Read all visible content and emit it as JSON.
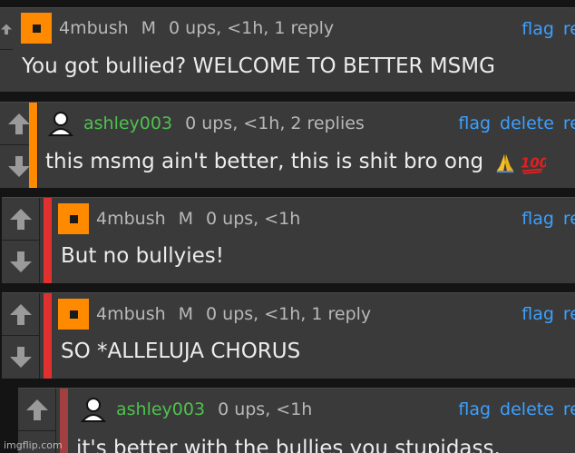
{
  "comments": [
    {
      "username": "4mbush",
      "badge": "M",
      "stats": "0 ups, <1h, 1 reply",
      "actions": [
        "flag",
        "re"
      ],
      "text": "You got bullied? WELCOME TO BETTER MSMG",
      "avatar": "orange-avatar",
      "stripe_color": ""
    },
    {
      "username": "ashley003",
      "badge": "",
      "stats": "0 ups, <1h, 2 replies",
      "actions": [
        "flag",
        "delete",
        "re"
      ],
      "text": "this msmg ain't better, this is shit bro ong",
      "emoji": [
        "folded-hands-emoji",
        "hundred-points-emoji"
      ],
      "avatar": "user-avatar",
      "stripe_color": "#ff8a00"
    },
    {
      "username": "4mbush",
      "badge": "M",
      "stats": "0 ups, <1h",
      "actions": [
        "flag",
        "re"
      ],
      "text": "But no bullyies!",
      "avatar": "orange-avatar",
      "stripe_color": "#e03030"
    },
    {
      "username": "4mbush",
      "badge": "M",
      "stats": "0 ups, <1h, 1 reply",
      "actions": [
        "flag",
        "re"
      ],
      "text": "SO *ALLELUJA CHORUS",
      "avatar": "orange-avatar",
      "stripe_color": "#e03030"
    },
    {
      "username": "ashley003",
      "badge": "",
      "stats": "0 ups, <1h",
      "actions": [
        "flag",
        "delete",
        "re"
      ],
      "text": "it's better with the bullies you stupidass.",
      "avatar": "user-avatar",
      "stripe_color": "#a04040"
    }
  ],
  "watermark": "imgflip.com",
  "colors": {
    "link": "#3ca0ff",
    "username_green": "#4ec24e",
    "avatar_orange": "#ff8a00",
    "stripe_red": "#e03030"
  }
}
